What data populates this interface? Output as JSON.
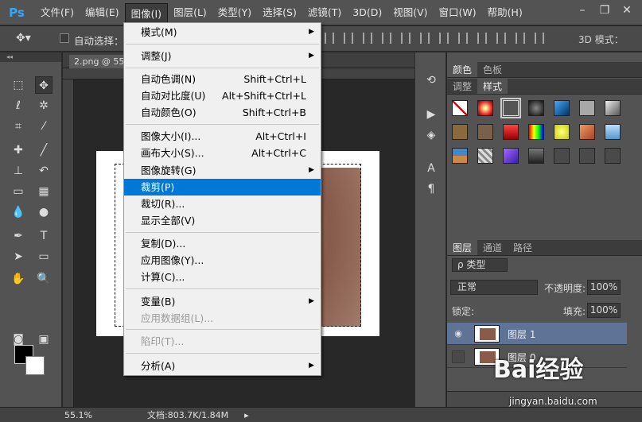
{
  "app": {
    "logo": "Ps"
  },
  "menubar": {
    "items": [
      {
        "label": "文件(F)"
      },
      {
        "label": "编辑(E)"
      },
      {
        "label": "图像(I)"
      },
      {
        "label": "图层(L)"
      },
      {
        "label": "类型(Y)"
      },
      {
        "label": "选择(S)"
      },
      {
        "label": "滤镜(T)"
      },
      {
        "label": "3D(D)"
      },
      {
        "label": "视图(V)"
      },
      {
        "label": "窗口(W)"
      },
      {
        "label": "帮助(H)"
      }
    ],
    "window_controls": {
      "minimize": "–",
      "restore": "❐",
      "close": "✕"
    }
  },
  "options_bar": {
    "auto_select_label": "自动选择：",
    "mode_3d_label": "3D 模式："
  },
  "document": {
    "tab_title": "2.png @ 55.",
    "zoom": "55.1%",
    "info": "文档:803.7K/1.84M"
  },
  "image_menu": {
    "items": [
      {
        "label": "模式(M)",
        "shortcut": "",
        "submenu": true,
        "enabled": true
      },
      {
        "label": "调整(J)",
        "shortcut": "",
        "submenu": true,
        "enabled": true
      },
      {
        "label": "自动色调(N)",
        "shortcut": "Shift+Ctrl+L",
        "submenu": false,
        "enabled": true
      },
      {
        "label": "自动对比度(U)",
        "shortcut": "Alt+Shift+Ctrl+L",
        "submenu": false,
        "enabled": true
      },
      {
        "label": "自动颜色(O)",
        "shortcut": "Shift+Ctrl+B",
        "submenu": false,
        "enabled": true
      },
      {
        "label": "图像大小(I)...",
        "shortcut": "Alt+Ctrl+I",
        "submenu": false,
        "enabled": true
      },
      {
        "label": "画布大小(S)...",
        "shortcut": "Alt+Ctrl+C",
        "submenu": false,
        "enabled": true
      },
      {
        "label": "图像旋转(G)",
        "shortcut": "",
        "submenu": true,
        "enabled": true
      },
      {
        "label": "裁剪(P)",
        "shortcut": "",
        "submenu": false,
        "enabled": true,
        "highlighted": true
      },
      {
        "label": "裁切(R)...",
        "shortcut": "",
        "submenu": false,
        "enabled": true
      },
      {
        "label": "显示全部(V)",
        "shortcut": "",
        "submenu": false,
        "enabled": true
      },
      {
        "label": "复制(D)...",
        "shortcut": "",
        "submenu": false,
        "enabled": true
      },
      {
        "label": "应用图像(Y)...",
        "shortcut": "",
        "submenu": false,
        "enabled": true
      },
      {
        "label": "计算(C)...",
        "shortcut": "",
        "submenu": false,
        "enabled": true
      },
      {
        "label": "变量(B)",
        "shortcut": "",
        "submenu": true,
        "enabled": true
      },
      {
        "label": "应用数据组(L)...",
        "shortcut": "",
        "submenu": false,
        "enabled": false
      },
      {
        "label": "陷印(T)...",
        "shortcut": "",
        "submenu": false,
        "enabled": false
      },
      {
        "label": "分析(A)",
        "shortcut": "",
        "submenu": true,
        "enabled": true
      }
    ]
  },
  "panels": {
    "color_tabs": [
      "颜色",
      "色板"
    ],
    "adjust_tabs": [
      "调整",
      "样式"
    ],
    "layers_tabs": [
      "图层",
      "通道",
      "路径"
    ],
    "filter_kind": "ρ 类型",
    "blend_mode": "正常",
    "opacity_label": "不透明度:",
    "opacity_value": "100%",
    "lock_label": "锁定:",
    "fill_label": "填充:",
    "fill_value": "100%",
    "layers": [
      {
        "name": "图层 1",
        "selected": true,
        "visible": true
      },
      {
        "name": "图层 0",
        "selected": false,
        "visible": false
      }
    ]
  },
  "watermark": {
    "brand": "Bai经验",
    "sub": "jingyan.baidu.com"
  },
  "colors": {
    "menu_highlight": "#0078d7",
    "foreground": "#000000",
    "background": "#ffffff",
    "layer_selected": "#5e7396",
    "ps_blue": "#31a8ff"
  }
}
